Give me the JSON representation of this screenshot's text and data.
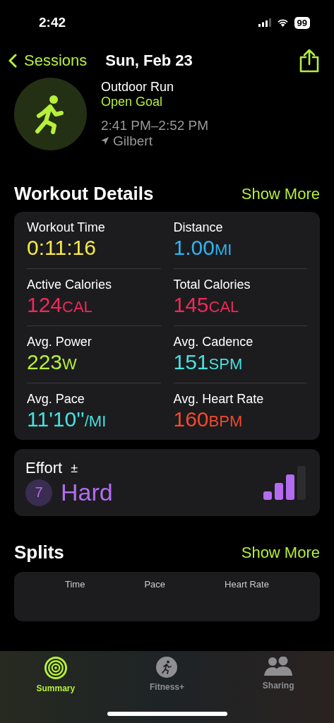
{
  "status_bar": {
    "time": "2:42",
    "battery": "99"
  },
  "nav": {
    "back": "Sessions",
    "title": "Sun, Feb 23"
  },
  "workout": {
    "name": "Outdoor Run",
    "goal": "Open Goal",
    "time_range": "2:41 PM–2:52 PM",
    "location": "Gilbert"
  },
  "details": {
    "title": "Workout Details",
    "action": "Show More",
    "metrics": [
      {
        "label": "Workout Time",
        "value": "0:11:16",
        "color": "#f5e94a"
      },
      {
        "label": "Distance",
        "value": "1.00",
        "unit": "MI",
        "color": "#2fb3f0"
      },
      {
        "label": "Active Calories",
        "value": "124",
        "unit": "CAL",
        "color": "#f0285a"
      },
      {
        "label": "Total Calories",
        "value": "145",
        "unit": "CAL",
        "color": "#f0285a"
      },
      {
        "label": "Avg. Power",
        "value": "223",
        "unit": "W",
        "color": "#b6f03a"
      },
      {
        "label": "Avg. Cadence",
        "value": "151",
        "unit": "SPM",
        "color": "#48e0e0"
      },
      {
        "label": "Avg. Pace",
        "value": "11'10''",
        "unit": "/MI",
        "color": "#48e0e0"
      },
      {
        "label": "Avg. Heart Rate",
        "value": "160",
        "unit": "BPM",
        "color": "#f04a30"
      }
    ]
  },
  "effort": {
    "title": "Effort",
    "adjust": "±",
    "score": "7",
    "rating": "Hard",
    "level": 0.75
  },
  "splits": {
    "title": "Splits",
    "action": "Show More",
    "columns": [
      "Time",
      "Pace",
      "Heart Rate"
    ]
  },
  "tabs": [
    {
      "label": "Summary",
      "selected": true,
      "kind": "rings"
    },
    {
      "label": "Fitness+",
      "selected": false,
      "kind": "runner"
    },
    {
      "label": "Sharing",
      "selected": false,
      "kind": "people"
    }
  ]
}
